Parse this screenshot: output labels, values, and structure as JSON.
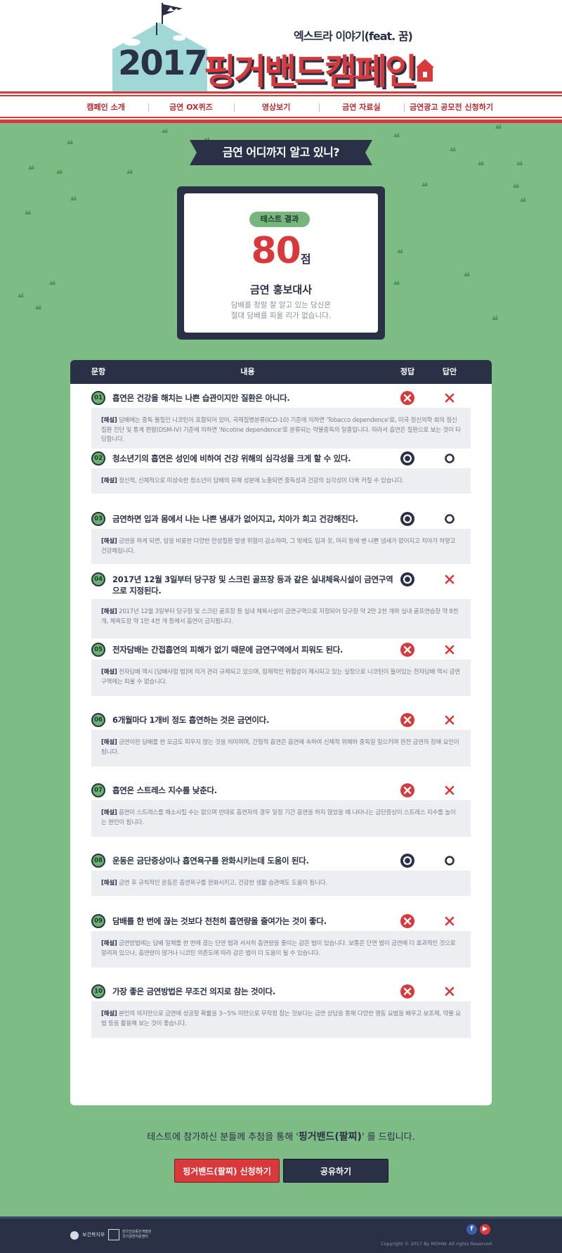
{
  "header": {
    "subtitle": "엑스트라 이야기(feat. 꿈)",
    "year": "2017",
    "title": "핑거밴드캠페인"
  },
  "nav": {
    "items": [
      "캠페인 소개",
      "금연 OX퀴즈",
      "영상보기",
      "금연 자료실",
      "금연광고 공모전 신청하기"
    ]
  },
  "section_title": "금연 어디까지 알고 있니?",
  "result": {
    "badge": "테스트 결과",
    "score": "80",
    "unit": "점",
    "title": "금연 홍보대사",
    "desc_line1": "담배를 정말 잘 알고 있는 당신은",
    "desc_line2": "절대 담배를 피울 리가 없습니다."
  },
  "table": {
    "headers": {
      "num": "문항",
      "content": "내용",
      "correct": "정답",
      "answer": "답안"
    },
    "questions": [
      {
        "num": "01",
        "text": "흡연은 건강을 해치는 나쁜 습관이지만 질환은 아니다.",
        "correct": "X",
        "answer": "X",
        "explain_label": "[해설]",
        "explain": "담배에는 중독 물질인 니코틴이 포함되어 있어, 국제질병분류(ICD-10) 기준에 의하면 'Tobacco dependence'로, 미국 정신의학 회의 정신질환 진단 및 통계 편람(DSM-IV) 기준에 의하면 'Nicotine dependence'로 분류되는 약물중독의 일종입니다. 따라서 흡연은 질환으로 보는 것이 타당합니다."
      },
      {
        "num": "02",
        "text": "청소년기의 흡연은 성인에 비하여 건강 위해의 심각성을 크게 할 수 있다.",
        "correct": "O",
        "answer": "O",
        "explain_label": "[해설]",
        "explain": "정신적, 신체적으로 미성숙한 청소년이 담배의 유해 성분에 노출되면 중독성과 건강의 심각성이 더욱 커질 수 있습니다."
      },
      {
        "num": "03",
        "text": "금연하면 입과 몸에서 나는 나쁜 냄새가 없어지고, 치아가 희고 건강해진다.",
        "correct": "O",
        "answer": "O",
        "explain_label": "[해설]",
        "explain": "금연을 하게 되면, 암을 비롯한 다양한 만성질환 발생 위험이 감소하며, 그 밖에도 입과 옷, 머리 등에 밴 나쁜 냄새가 없어지고 치아가 하얗고 건강해집니다."
      },
      {
        "num": "04",
        "text": "2017년 12월 3일부터 당구장 및 스크린 골프장 등과 같은 실내체육시설이 금연구역으로 지정된다.",
        "correct": "O",
        "answer": "X",
        "explain_label": "[해설]",
        "explain": "2017년 12월 3일부터 당구장 및 스크린 골프장 등 실내 체육시설이 금연구역으로 지정되어 당구장 약 2만 2천 개와 실내 골프연습장 약 8천 개, 체육도장 약 1만 4천 개 등에서 흡연이 금지됩니다."
      },
      {
        "num": "05",
        "text": "전자담배는 간접흡연의 피해가 없기 때문에 금연구역에서 피워도 된다.",
        "correct": "X",
        "answer": "X",
        "explain_label": "[해설]",
        "explain": "전자담배 역시 [담배사업 법]에 의거 관리 규제되고 있으며, 잠재적인 위험성이 제시되고 있는 실정으로 니코틴이 들어있는 전자담배 역시 금연구역에는 피울 수 없습니다."
      },
      {
        "num": "06",
        "text": "6개월마다 1개비 정도 흡연하는 것은 금연이다.",
        "correct": "X",
        "answer": "X",
        "explain_label": "[해설]",
        "explain": "금연이란 담배를 한 모금도 피우지 않는 것을 의미하며, 간헐적 흡연은 흡연에 속하여 신체적 위해와 중독일 일으키며 완전 금연의 장애 요인이 됩니다."
      },
      {
        "num": "07",
        "text": "흡연은 스트레스 지수를 낮춘다.",
        "correct": "X",
        "answer": "X",
        "explain_label": "[해설]",
        "explain": "흡연이 스트레스를 해소시킬 수는 없으며 반대로 흡연자의 경우 일정 기간 흡연을 하지 않았을 때 나타나는 금단증상이 스트레스 지수를 높이는 원인이 됩니다."
      },
      {
        "num": "08",
        "text": "운동은 금단증상이나 흡연욕구를 완화시키는데 도움이 된다.",
        "correct": "O",
        "answer": "O",
        "explain_label": "[해설]",
        "explain": "금연 후 규칙적인 운동은 흡연욕구를 완화시키고, 건강한 생활 습관에도 도움이 됩니다."
      },
      {
        "num": "09",
        "text": "담배를 한 번에 끊는 것보다 천천히 흡연량을 줄여가는 것이 좋다.",
        "correct": "X",
        "answer": "X",
        "explain_label": "[해설]",
        "explain": "금연방법에는 담배 일체를 한 번에 끊는 단연 법과 서서히 흡연량을 줄이는 감은 법이 있습니다. 보통은 단연 법이 금연에 더 효과적인 것으로 알려져 있으나, 흡연량이 많거나 니코틴 의존도에 따라 감은 법이 더 도움이 될 수 있습니다."
      },
      {
        "num": "10",
        "text": "가장 좋은 금연방법은 무조건 의지로 참는 것이다.",
        "correct": "X",
        "answer": "X",
        "explain_label": "[해설]",
        "explain": "본인의 의지만으로 금연에 성공할 확률을 3~5% 미만으로 무작정 참는 것보다는 금연 상담을 통해 다양한 행동 요법을 배우고 보조제, 약물 요법 등을 활용해 보는 것이 좋습니다."
      }
    ]
  },
  "notice": {
    "prefix": "테스트에 참가하신 분들께 추첨을 통해 '",
    "highlight": "핑거밴드(팔찌)",
    "suffix": "' 를 드립니다."
  },
  "buttons": {
    "apply": "핑거밴드(팔찌) 신청하기",
    "share": "공유하기"
  },
  "footer": {
    "org1": "보건복지부",
    "org2_line1": "한국건강증진개발원",
    "org2_line2": "국가금연지원센터",
    "fb": "f",
    "yt": "▶",
    "copyright": "Copyright © 2017 By MOHW. All rights Reserved"
  },
  "colors": {
    "navy": "#2a3147",
    "red": "#d9393b",
    "green": "#7dbc84"
  }
}
